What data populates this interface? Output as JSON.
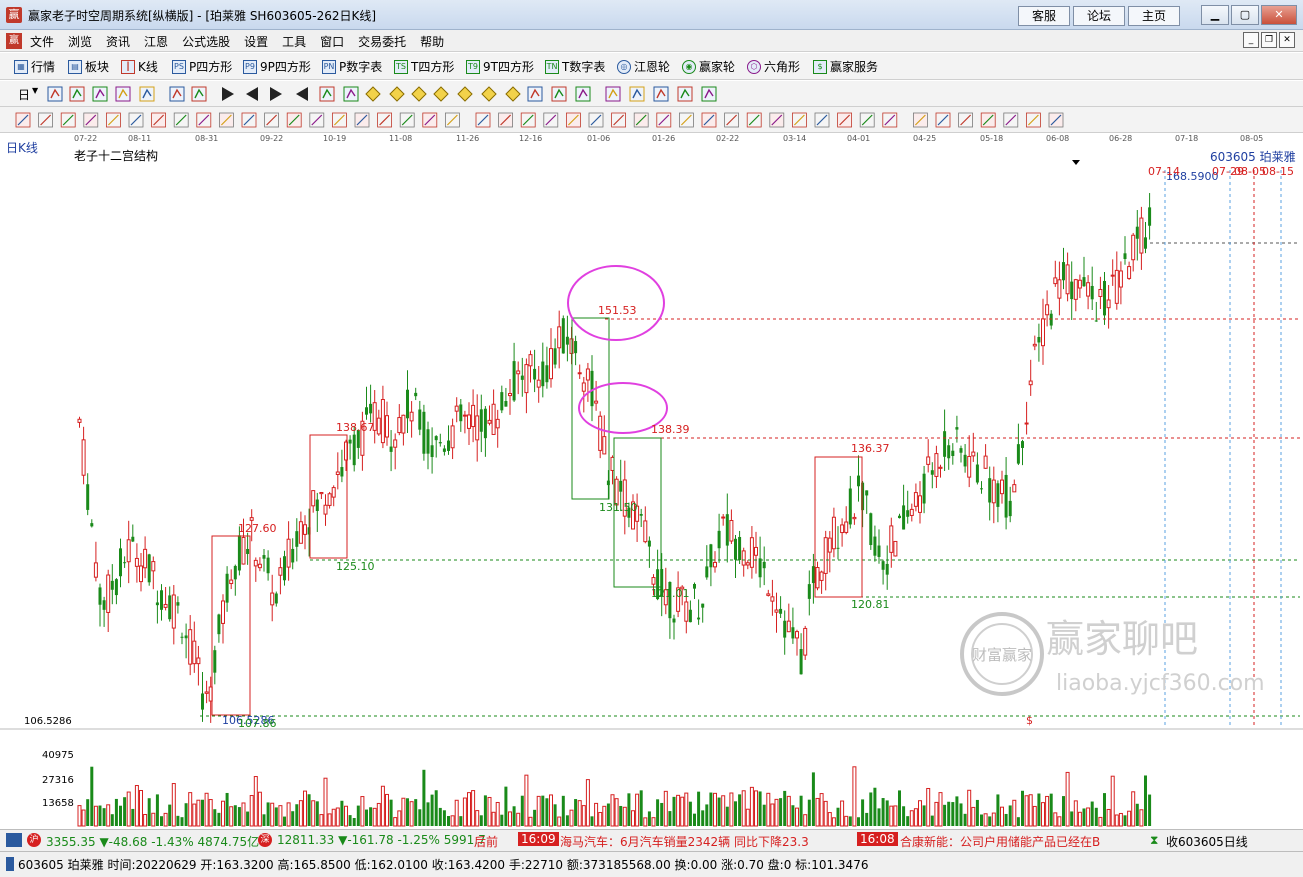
{
  "window": {
    "title": "赢家老子时空周期系统[纵横版] - [珀莱雅  SH603605-262日K线]",
    "links": [
      "客服",
      "论坛",
      "主页"
    ]
  },
  "menu": {
    "items": [
      "文件",
      "浏览",
      "资讯",
      "江恩",
      "公式选股",
      "设置",
      "工具",
      "窗口",
      "交易委托",
      "帮助"
    ]
  },
  "toolbar": {
    "items": [
      "行情",
      "板块",
      "K线",
      "P四方形",
      "9P四方形",
      "P数字表",
      "T四方形",
      "9T四方形",
      "T数字表",
      "江恩轮",
      "赢家轮",
      "六角形",
      "赢家服务"
    ],
    "period": "日"
  },
  "chart": {
    "period_label": "日K线",
    "indicator_name": "老子十二宫结构",
    "stock_code": "603605",
    "stock_name": "珀莱雅",
    "dates": [
      "07-22",
      "08-11",
      "08-31",
      "09-22",
      "10-19",
      "11-08",
      "11-26",
      "12-16",
      "01-06",
      "01-26",
      "02-22",
      "03-14",
      "04-01",
      "04-25",
      "05-18",
      "06-08",
      "06-28",
      "07-18",
      "08-05"
    ],
    "price_labels": {
      "p151": "151.53",
      "p138_39": "138.39",
      "p138_6": "138.67",
      "p136": "136.37",
      "p131": "131.50",
      "p127": "127.60",
      "p125": "125.10",
      "p121": "121.01",
      "p120": "120.81",
      "p106": "106.5286",
      "p106b": "106.5286",
      "p107": "107.86",
      "high": "168.5900",
      "d1": "07-14",
      "d2": "07-29",
      "d3": "08-05",
      "d4": "08-15",
      "dollar": "$"
    },
    "y_axis_price": "106.5286",
    "volume_ticks": [
      "40975",
      "27316",
      "13658"
    ]
  },
  "status": {
    "sh_index": "3355.35",
    "sh_change": "▼-48.68",
    "sh_pct": "-1.43%",
    "sh_amount": "4874.75亿",
    "sz_index": "12811.33",
    "sz_change": "▼-161.78",
    "sz_pct": "-1.25%",
    "sz_amount": "5991.7",
    "news1_prefix": "后前",
    "news1_time": "16:09",
    "news1_text": "海马汽车：6月汽车销量2342辆 同比下降23.3",
    "news2_time": "16:08",
    "news2_text": "合康新能：公司户用储能产品已经在B",
    "right_text": "收603605日线"
  },
  "infobar": {
    "text": "603605 珀莱雅 时间:20220629 开:163.3200 高:165.8500 低:162.0100 收:163.4200 手:22710 额:373185568.00 换:0.00 涨:0.70 盘:0 标:101.3476"
  },
  "watermark": {
    "brand": "赢家聊吧",
    "url": "liaoba.yjcf360.com",
    "seal": "财富赢家"
  },
  "colors": {
    "up": "#d62020",
    "down": "#1a8a1a",
    "accent": "#1f3fa0",
    "ellipse": "#e040e0"
  }
}
